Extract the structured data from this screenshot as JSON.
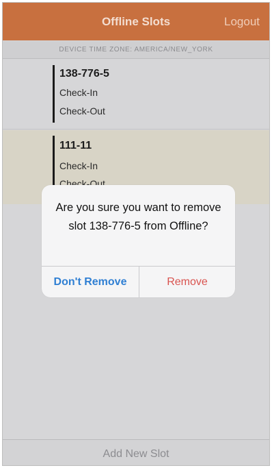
{
  "navbar": {
    "title": "Offline Slots",
    "logout_label": "Logout"
  },
  "timezone_label": "DEVICE TIME ZONE: AMERICA/NEW_YORK",
  "slots": [
    {
      "id": "138-776-5",
      "line1": "Check-In",
      "line2": "Check-Out"
    },
    {
      "id": "111-11",
      "line1": "Check-In",
      "line2": "Check-Out"
    }
  ],
  "alert": {
    "message": "Are you sure you want to remove slot 138-776-5 from Offline?",
    "cancel_label": "Don't Remove",
    "confirm_label": "Remove"
  },
  "footer": {
    "add_label": "Add New Slot"
  },
  "colors": {
    "navbar": "#c8703f",
    "highlight_row": "#d8d4c6",
    "cancel": "#2f7fd3",
    "destructive": "#d9534f"
  }
}
